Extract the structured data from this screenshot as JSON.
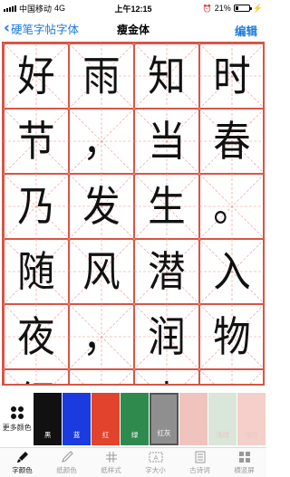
{
  "status_bar": {
    "carrier": "中国移动",
    "network": "4G",
    "time": "上午12:15",
    "battery_percent": "21%",
    "battery_level": 0.21
  },
  "nav": {
    "back_label": "硬笔字帖字体",
    "title": "瘦金体",
    "edit_label": "编辑"
  },
  "grid": {
    "line_color": "#d95545",
    "guide_color": "#e7948a",
    "characters": [
      "好",
      "雨",
      "知",
      "时",
      "节",
      "，",
      "当",
      "春",
      "乃",
      "发",
      "生",
      "。",
      "随",
      "风",
      "潜",
      "入",
      "夜",
      "，",
      "润",
      "物",
      "细",
      "无",
      "声",
      "。"
    ]
  },
  "palette": {
    "more_label": "更多颜色",
    "swatches": [
      {
        "label": "黑",
        "color": "#111111",
        "selected": false
      },
      {
        "label": "蓝",
        "color": "#1a3be0",
        "selected": false
      },
      {
        "label": "红",
        "color": "#e2432d",
        "selected": false
      },
      {
        "label": "绿",
        "color": "#2f8a4e",
        "selected": false
      },
      {
        "label": "红灰",
        "color": "#8f8f8f",
        "selected": true
      },
      {
        "label": "浅红",
        "color": "#f0c3bd",
        "selected": false
      },
      {
        "label": "浅绿",
        "color": "#d9e6d9",
        "selected": false
      },
      {
        "label": "浅红",
        "color": "#f5cfc9",
        "selected": false
      }
    ]
  },
  "tabs": [
    {
      "label": "字颜色",
      "icon": "brush-icon",
      "active": true
    },
    {
      "label": "纸颜色",
      "icon": "pen-icon",
      "active": false
    },
    {
      "label": "纸样式",
      "icon": "grid-icon",
      "active": false
    },
    {
      "label": "字大小",
      "icon": "font-size-icon",
      "active": false
    },
    {
      "label": "古诗词",
      "icon": "book-icon",
      "active": false
    },
    {
      "label": "横竖屏",
      "icon": "rotate-icon",
      "active": false
    }
  ]
}
